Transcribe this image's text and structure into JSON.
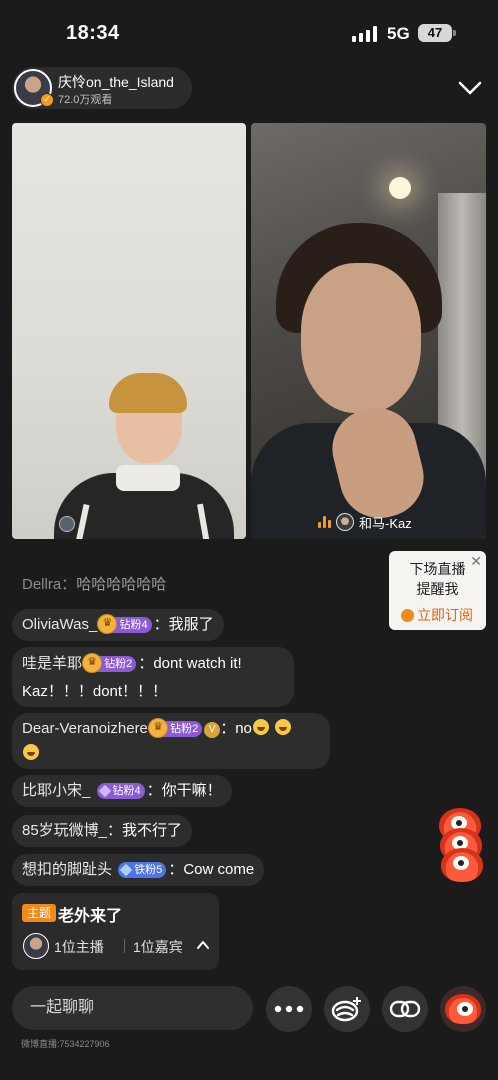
{
  "status_bar": {
    "time": "18:34",
    "network": "5G",
    "battery": "47"
  },
  "host": {
    "name": "庆怜on_the_Island",
    "viewers": "72.0万观看"
  },
  "videos": {
    "right_guest_name": "和马-Kaz"
  },
  "subscribe_card": {
    "line1": "下场直播",
    "line2": "提醒我",
    "action": "立即订阅"
  },
  "comments": [
    {
      "user": "Dellra：",
      "text": "哈哈哈哈哈哈"
    },
    {
      "user": "OliviaWas_",
      "badge": "钻粉4",
      "text": "：我服了"
    },
    {
      "user": "哇是羊耶",
      "badge": "钻粉2",
      "text": "：dont watch it!",
      "text2": "Kaz！！！dont！！！"
    },
    {
      "user": "Dear-Veranoizhere",
      "badge": "钻粉2",
      "v_badge": "V",
      "text": "：no"
    },
    {
      "user": "比耶小宋_",
      "badge": "钻粉4",
      "text": "：你干嘛！"
    },
    {
      "user": "85岁玩微博_",
      "text": "：我不行了"
    },
    {
      "user": "想扣的脚趾头",
      "badge": "铁粉5",
      "text": "：Cow come"
    }
  ],
  "topic": {
    "tag": "主题",
    "title": "老外来了",
    "hosts": "1位主播",
    "guests": "1位嘉宾"
  },
  "bottom_bar": {
    "input_placeholder": "一起聊聊",
    "footer_id": "微博直播:7534227906"
  },
  "colors": {
    "background": "#1b1b1b",
    "accent_orange": "#f08a1c",
    "badge_purple": "#8d5ad6",
    "badge_blue": "#4f74e6"
  },
  "icons": [
    "signal-icon",
    "battery-icon",
    "verified-icon",
    "chevron-down-icon",
    "audio-level-icon",
    "close-icon",
    "bell-icon",
    "chevron-up-icon",
    "more-icon",
    "gift-plus-icon",
    "link-icon",
    "mascot-icon"
  ]
}
